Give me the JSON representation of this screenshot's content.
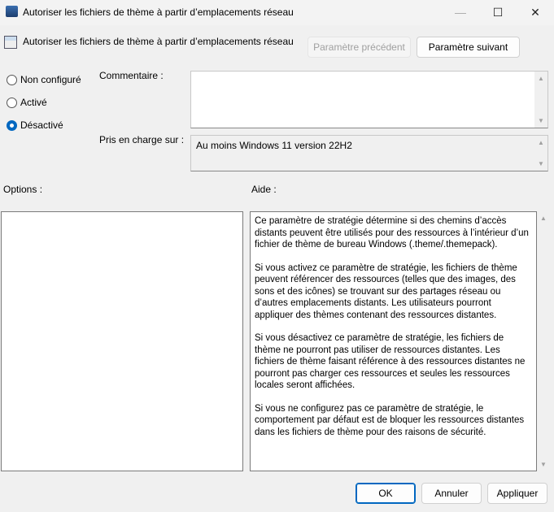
{
  "window": {
    "title": "Autoriser les fichiers de thème à partir d’emplacements réseau",
    "minimize": "—",
    "maximize": "☐",
    "close": "✕"
  },
  "header": {
    "policy_name": "Autoriser les fichiers de thème à partir d’emplacements réseau",
    "prev_button": "Paramètre précédent",
    "next_button": "Paramètre suivant"
  },
  "state": {
    "options": [
      {
        "label": "Non configuré",
        "selected": false
      },
      {
        "label": "Activé",
        "selected": false
      },
      {
        "label": "Désactivé",
        "selected": true
      }
    ]
  },
  "comment": {
    "label": "Commentaire :",
    "value": ""
  },
  "supported": {
    "label": "Pris en charge sur :",
    "value": "Au moins Windows 11 version 22H2"
  },
  "options_label": "Options :",
  "help_label": "Aide :",
  "help_text": [
    "Ce paramètre de stratégie détermine si des chemins d’accès distants peuvent être utilisés pour des ressources à l’intérieur d’un fichier de thème de bureau Windows (.theme/.themepack).",
    "Si vous activez ce paramètre de stratégie, les fichiers de thème peuvent référencer des ressources (telles que des images, des sons et des icônes) se trouvant sur des partages réseau ou d’autres emplacements distants. Les utilisateurs pourront appliquer des thèmes contenant des ressources distantes.",
    "Si vous désactivez ce paramètre de stratégie, les fichiers de thème ne pourront pas utiliser de ressources distantes. Les fichiers de thème faisant référence à des ressources distantes ne pourront pas charger ces ressources et seules les ressources locales seront affichées.",
    "Si vous ne configurez pas ce paramètre de stratégie, le comportement par défaut est de bloquer les ressources distantes dans les fichiers de thème pour des raisons de sécurité."
  ],
  "footer": {
    "ok": "OK",
    "cancel": "Annuler",
    "apply": "Appliquer"
  }
}
